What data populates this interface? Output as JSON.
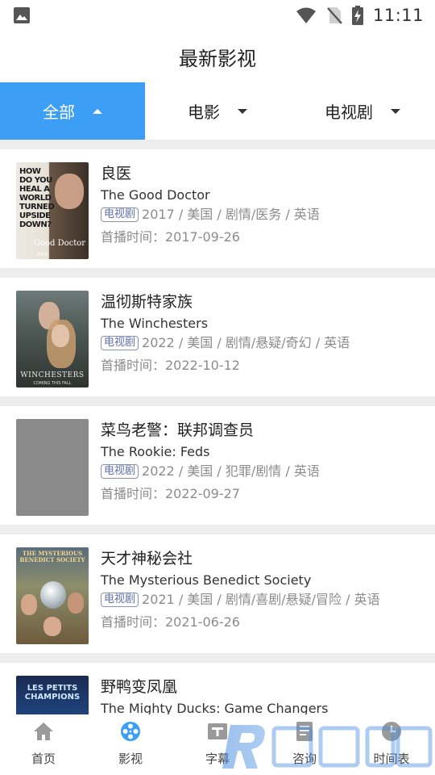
{
  "status_bar": {
    "time": "11:11"
  },
  "header": {
    "title": "最新影视"
  },
  "filters": [
    {
      "label": "全部",
      "active": true
    },
    {
      "label": "电影",
      "active": false
    },
    {
      "label": "电视剧",
      "active": false
    }
  ],
  "shows": [
    {
      "title_cn": "良医",
      "title_en": "The Good Doctor",
      "type": "电视剧",
      "details": "2017 / 美国 / 剧情/医务 / 英语",
      "premiere": "首播时间：2017-09-26",
      "poster_text": "HOW DO YOU HEAL A WORLD TURNED UPSIDE DOWN?",
      "poster_title": "Good Doctor",
      "poster_brand": "AXN"
    },
    {
      "title_cn": "温彻斯特家族",
      "title_en": "The Winchesters",
      "type": "电视剧",
      "details": "2022 / 美国 / 剧情/悬疑/奇幻 / 英语",
      "premiere": "首播时间：2022-10-12",
      "poster_title": "WINCHESTERS",
      "poster_tagline": "COMING THIS FALL"
    },
    {
      "title_cn": "菜鸟老警：联邦调查员",
      "title_en": "The Rookie: Feds",
      "type": "电视剧",
      "details": "2022 / 美国 / 犯罪/剧情 / 英语",
      "premiere": "首播时间：2022-09-27"
    },
    {
      "title_cn": "天才神秘会社",
      "title_en": "The Mysterious Benedict Society",
      "type": "电视剧",
      "details": "2021 / 美国 / 剧情/喜剧/悬疑/冒险 / 英语",
      "premiere": "首播时间：2021-06-26",
      "poster_title": "THE MYSTERIOUS BENEDICT SOCIETY"
    },
    {
      "title_cn": "野鸭变凤凰",
      "title_en": "The Mighty Ducks: Game Changers",
      "poster_title": "LES PETITS CHAMPIONS"
    }
  ],
  "bottom_nav": [
    {
      "label": "首页",
      "icon": "home-icon"
    },
    {
      "label": "影视",
      "icon": "film-reel-icon"
    },
    {
      "label": "字幕",
      "icon": "subtitle-icon"
    },
    {
      "label": "咨询",
      "icon": "document-icon"
    },
    {
      "label": "时间表",
      "icon": "clock-icon"
    }
  ],
  "colors": {
    "accent": "#3d9ef5",
    "badge": "#6270a8",
    "watermark": "#4a8fe0"
  }
}
